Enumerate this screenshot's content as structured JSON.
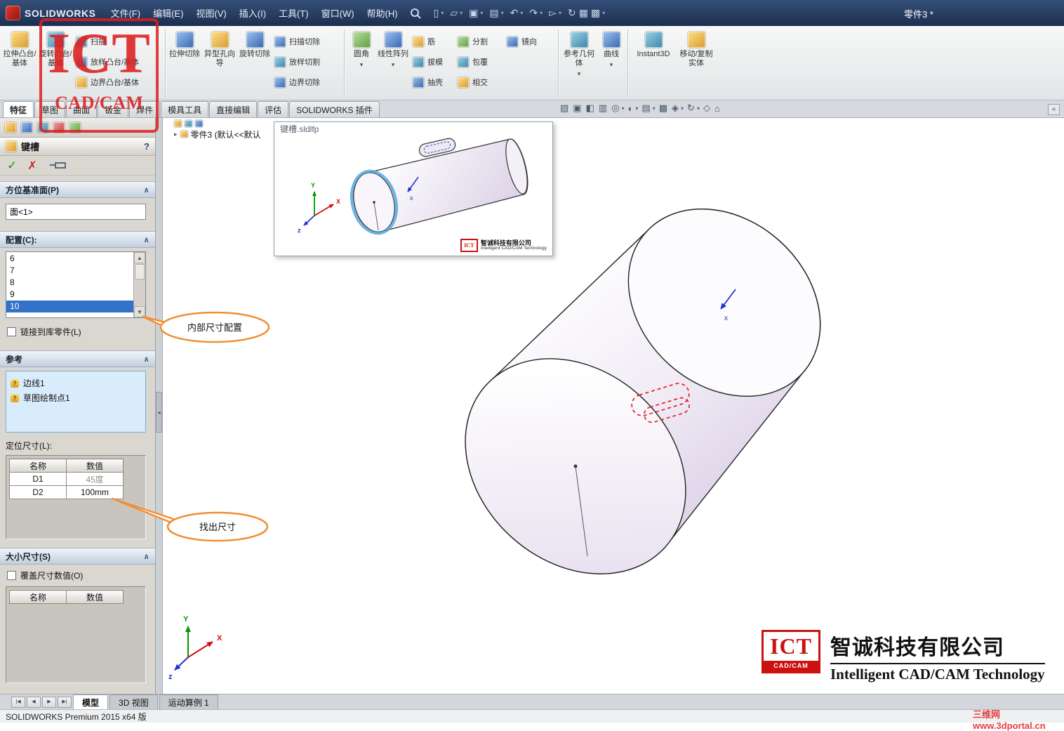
{
  "colors": {
    "accent_blue": "#3272c8",
    "selection_blue": "#54a7e0",
    "callout_orange": "#ef8f35",
    "sketch_red": "#e01818",
    "brand_red": "#cc1111",
    "titlebar_navy": "#24395d"
  },
  "ui": {
    "caret": "▾",
    "collapse": "«",
    "help": "?",
    "ok": "✓",
    "cancel": "✗",
    "chevron": "∧",
    "scroll_up": "▲",
    "scroll_down": "▼",
    "tree_caret": "▸",
    "split_arrow": "◂",
    "x_mark": "x"
  },
  "titlebar": {
    "brand": "SOLIDWORKS",
    "menus": [
      "文件(F)",
      "编辑(E)",
      "视图(V)",
      "插入(I)",
      "工具(T)",
      "窗口(W)",
      "帮助(H)"
    ],
    "doc_title": "零件3 *"
  },
  "qat": {
    "icons": [
      {
        "name": "new",
        "glyph": "▯"
      },
      {
        "name": "open",
        "glyph": "▱"
      },
      {
        "name": "save",
        "glyph": "▣"
      },
      {
        "name": "print",
        "glyph": "▤"
      },
      {
        "name": "undo",
        "glyph": "↶"
      },
      {
        "name": "redo",
        "glyph": "↷"
      },
      {
        "name": "select",
        "glyph": "▻"
      },
      {
        "name": "rebuild",
        "glyph": "↻"
      },
      {
        "name": "file-properties",
        "glyph": "▦"
      },
      {
        "name": "options",
        "glyph": "▩"
      }
    ]
  },
  "ribbon": {
    "buttons": [
      "拉伸凸台/基体",
      "旋转凸台/基体",
      "扫描",
      "放样凸台/基体",
      "边界凸台/基体",
      "拉伸切除",
      "异型孔向导",
      "旋转切除",
      "扫描切除",
      "放样切割",
      "边界切除",
      "圆角",
      "线性阵列",
      "筋",
      "拔模",
      "抽壳",
      "分割",
      "包覆",
      "相交",
      "镜向",
      "参考几何体",
      "曲线",
      "Instant3D",
      "移动/复制实体"
    ]
  },
  "tabs": {
    "items": [
      "特征",
      "草图",
      "曲面",
      "钣金",
      "焊件",
      "模具工具",
      "直接编辑",
      "评估",
      "SOLIDWORKS 插件"
    ],
    "active": "特征"
  },
  "hud": {
    "icons": [
      "▧",
      "▣",
      "◧",
      "▥",
      "◎",
      "◐",
      "▤",
      "▩",
      "◈",
      "↻",
      "◇",
      "⌂"
    ]
  },
  "pm": {
    "title": "键槽",
    "sections": {
      "orientation": {
        "label": "方位基准面(P)",
        "value": "面<1>"
      },
      "config": {
        "label": "配置(C):",
        "options": [
          "6",
          "7",
          "8",
          "9",
          "10"
        ],
        "selected": "10",
        "link_label": "链接到库零件(L)"
      },
      "references": {
        "label": "参考",
        "items": [
          "边线1",
          "草图绘制点1"
        ]
      },
      "locating": {
        "label": "定位尺寸(L):",
        "headers": [
          "名称",
          "数值"
        ],
        "rows": [
          {
            "name": "D1",
            "value": "45度"
          },
          {
            "name": "D2",
            "value": "100mm"
          }
        ]
      },
      "size": {
        "label": "大小尺寸(S)",
        "override_label": "覆盖尺寸数值(O)",
        "headers": [
          "名称",
          "数值"
        ]
      }
    }
  },
  "callouts": {
    "config": "内部尺寸配置",
    "dims": "找出尺寸"
  },
  "feature_tree": {
    "root": "零件3 (默认<<默认"
  },
  "preview": {
    "title": "键槽.sldlfp",
    "triad": {
      "x": "X",
      "y": "Y",
      "z": "z"
    },
    "logo": {
      "ict": "ICT",
      "company": "智诚科技有限公司",
      "tagline": "Intelligent CAD/CAM Technology"
    }
  },
  "viewport": {
    "triad": {
      "x": "X",
      "y": "Y",
      "z": "z"
    }
  },
  "bottom_bar": {
    "nav": [
      "|◀",
      "◀",
      "▶",
      "▶|"
    ],
    "tabs": [
      "模型",
      "3D 视图",
      "运动算例 1"
    ],
    "active": "模型"
  },
  "statusbar": {
    "text": "SOLIDWORKS Premium 2015 x64 版"
  },
  "watermark": {
    "ict": "ICT",
    "cadcam": "CAD/CAM",
    "site": "三维网www.3dportal.cn"
  },
  "corner_logo": {
    "ict": "ICT",
    "cadcam": "CAD/CAM",
    "company": "智诚科技有限公司",
    "tagline": "Intelligent CAD/CAM Technology"
  }
}
